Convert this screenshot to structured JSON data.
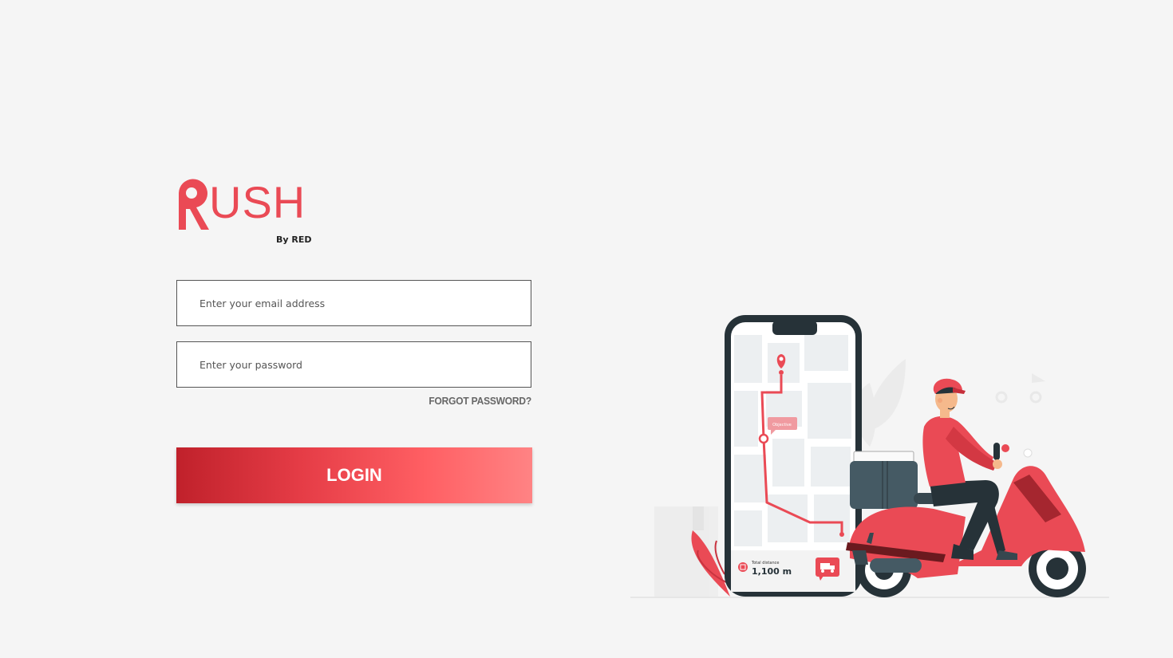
{
  "brand": {
    "name": "RUSH",
    "word_rest": "USH",
    "tagline": "By RED",
    "color": "#ea4a55"
  },
  "login_form": {
    "email_placeholder": "Enter your email address",
    "password_placeholder": "Enter your password",
    "forgot_label": "FORGOT PASSWORD?",
    "login_label": "LOGIN"
  },
  "illustration": {
    "map_tag": "Objective",
    "distance_label": "Total distance",
    "distance_value": "1,100 m",
    "icons": [
      "map-pin-icon",
      "truck-icon",
      "route-icon"
    ]
  },
  "colors": {
    "accent": "#ea4a55",
    "button_start": "#c0212b",
    "button_end": "#ff8384",
    "background": "#f5f5f5"
  }
}
